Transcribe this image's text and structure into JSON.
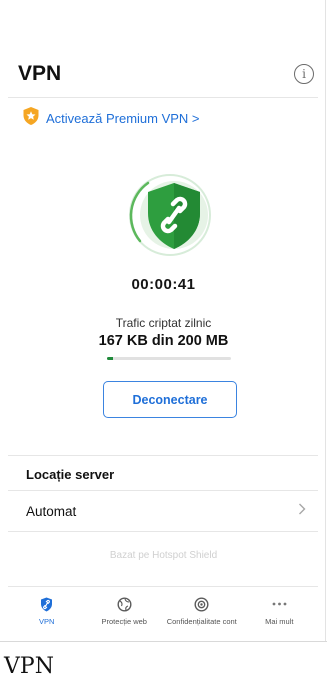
{
  "header": {
    "title": "VPN",
    "info_icon": "info-icon"
  },
  "premium": {
    "label": "Activează Premium VPN >",
    "icon": "premium-shield-star-icon",
    "color": "#1f6fd8"
  },
  "status": {
    "icon": "connected-shield-icon",
    "timer": "00:00:41",
    "traffic_label": "Trafic criptat zilnic",
    "traffic_value": "167 KB din 200 MB",
    "traffic_fraction": 0.05,
    "accent": "#1f8a3a"
  },
  "actions": {
    "disconnect_label": "Deconectare"
  },
  "location": {
    "section_title": "Locație server",
    "value": "Automat",
    "chevron_icon": "chevron-right-icon"
  },
  "footer_note": "Bazat pe Hotspot Shield",
  "tabs": [
    {
      "label": "VPN",
      "icon": "vpn-shield-icon",
      "active": true
    },
    {
      "label": "Protecție web",
      "icon": "web-protection-icon",
      "active": false
    },
    {
      "label": "Confidențialitate cont",
      "icon": "account-privacy-icon",
      "active": false
    },
    {
      "label": "Mai mult",
      "icon": "more-dots-icon",
      "active": false
    }
  ],
  "caption": "VPN"
}
